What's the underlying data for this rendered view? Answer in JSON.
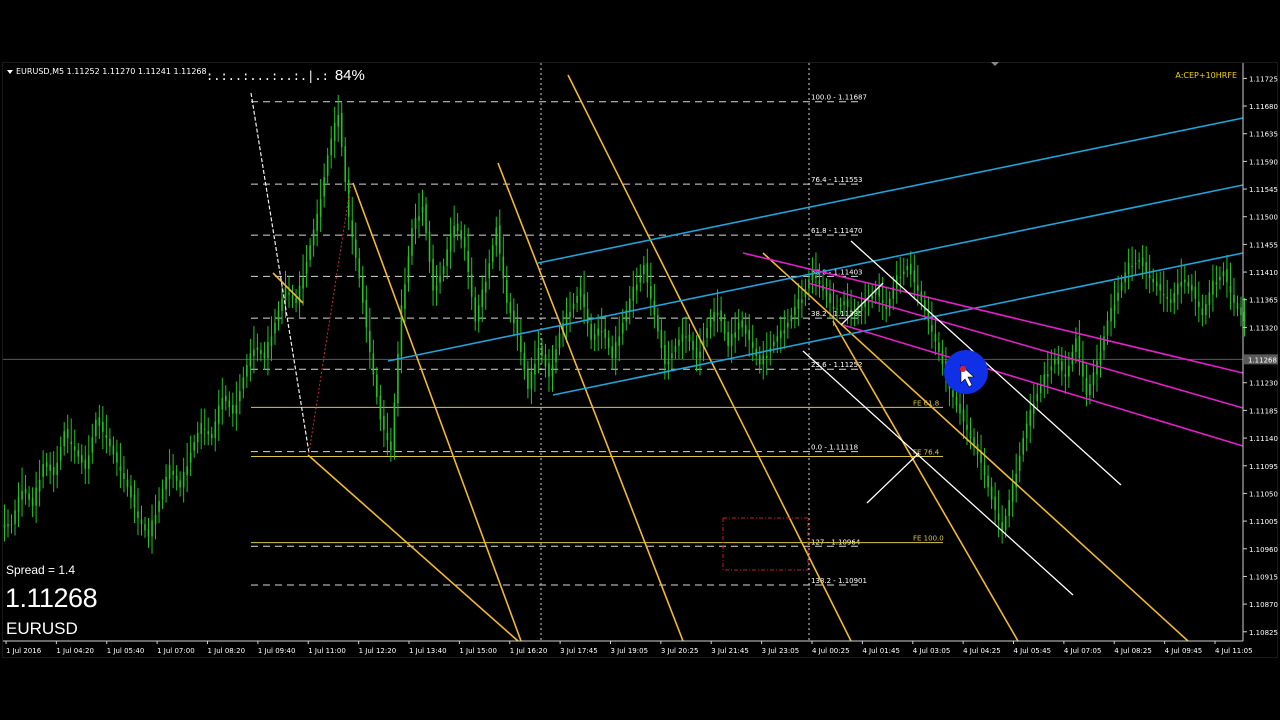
{
  "window": {
    "symbol_info": "EURUSD,M5  1.11252 1.11270 1.11241 1.11268",
    "timer_dots": ":.:..:...:..:.|.:",
    "timer_percent": "84%",
    "indicator_label": "A:CEP+10HRFE",
    "spread_text": "Spread = 1.4",
    "big_price": "1.11268",
    "big_symbol": "EURUSD"
  },
  "colors": {
    "background": "#000000",
    "candles": "#22c322",
    "yellow_channel": "#f2b830",
    "blue_channel": "#1fa3d8",
    "magenta_channel": "#e020c8",
    "white_lines": "#ffffff",
    "fib_dashed": "#d8d8d8",
    "fe_lines": "#d8c840",
    "current_price_line": "#5a5a5a",
    "price_tag_bg": "#5a5a5a",
    "cursor_circle": "#1030e8"
  },
  "chart_data": {
    "type": "line",
    "symbol": "EURUSD",
    "timeframe": "M5",
    "ohlc_current": {
      "open": 1.11252,
      "high": 1.1127,
      "low": 1.11241,
      "close": 1.11268
    },
    "current_price": 1.11268,
    "ylim": [
      1.1081,
      1.1175
    ],
    "y_ticks": [
      1.11725,
      1.1168,
      1.11635,
      1.1159,
      1.11545,
      1.115,
      1.11455,
      1.1141,
      1.11365,
      1.1132,
      1.1123,
      1.11185,
      1.1114,
      1.11095,
      1.1105,
      1.11005,
      1.1096,
      1.10915,
      1.1087,
      1.10825
    ],
    "y_tick_labels": [
      "1.11725",
      "1.11680",
      "1.11635",
      "1.11590",
      "1.11545",
      "1.11500",
      "1.11455",
      "1.11410",
      "1.11365",
      "1.11320",
      "1.11230",
      "1.11185",
      "1.11140",
      "1.11095",
      "1.11050",
      "1.11005",
      "1.10960",
      "1.10915",
      "1.10870",
      "1.10825"
    ],
    "x_labels": [
      "1 Jul 2016",
      "1 Jul 04:20",
      "1 Jul 05:40",
      "1 Jul 07:00",
      "1 Jul 08:20",
      "1 Jul 09:40",
      "1 Jul 11:00",
      "1 Jul 12:20",
      "1 Jul 13:40",
      "1 Jul 15:00",
      "1 Jul 16:20",
      "3 Jul 17:45",
      "3 Jul 19:05",
      "3 Jul 20:25",
      "3 Jul 21:45",
      "3 Jul 23:05",
      "4 Jul 00:25",
      "4 Jul 01:45",
      "4 Jul 03:05",
      "4 Jul 04:25",
      "4 Jul 05:45",
      "4 Jul 07:05",
      "4 Jul 08:25",
      "4 Jul 09:45",
      "4 Jul 11:05"
    ],
    "series": [
      {
        "values": [
          1.11,
          1.1106,
          1.1103,
          1.111,
          1.1108,
          1.1115,
          1.1112,
          1.1109,
          1.1117,
          1.1114,
          1.111,
          1.1106,
          1.1101,
          1.1098,
          1.1104,
          1.1109,
          1.1106,
          1.1112,
          1.1116,
          1.1114,
          1.1121,
          1.1118,
          1.1124,
          1.1129,
          1.1127,
          1.1133,
          1.1138,
          1.1136,
          1.1143,
          1.115,
          1.116,
          1.1167,
          1.115,
          1.114,
          1.1128,
          1.1117,
          1.1112,
          1.1135,
          1.1148,
          1.1152,
          1.1138,
          1.1142,
          1.1149,
          1.1145,
          1.1133,
          1.114,
          1.1148,
          1.1136,
          1.1131,
          1.1122,
          1.1129,
          1.1124,
          1.1131,
          1.1135,
          1.1138,
          1.113,
          1.1132,
          1.1127,
          1.1133,
          1.1138,
          1.1142,
          1.1134,
          1.1126,
          1.1129,
          1.1131,
          1.1127,
          1.1132,
          1.1135,
          1.1129,
          1.1133,
          1.113,
          1.1126,
          1.1129,
          1.1131,
          1.1134,
          1.1137,
          1.1141,
          1.1138,
          1.1135,
          1.1136,
          1.1134,
          1.1136,
          1.1138,
          1.1135,
          1.114,
          1.1142,
          1.1138,
          1.1133,
          1.1128,
          1.1122,
          1.1118,
          1.1114,
          1.111,
          1.1104,
          1.1099,
          1.1106,
          1.1114,
          1.112,
          1.1124,
          1.1127,
          1.1124,
          1.113,
          1.1121,
          1.1126,
          1.1133,
          1.1138,
          1.1142,
          1.1143,
          1.114,
          1.1138,
          1.1136,
          1.114,
          1.1138,
          1.1134,
          1.1139,
          1.1141,
          1.1136,
          1.1133
        ]
      }
    ],
    "fibonacci_retracement": [
      {
        "label": "100.0 - 1.11687",
        "value": 1.11687
      },
      {
        "label": "76.4 - 1.11553",
        "value": 1.11553
      },
      {
        "label": "61.8 - 1.11470",
        "value": 1.1147
      },
      {
        "label": "50.0 - 1.11403",
        "value": 1.11403
      },
      {
        "label": "38.2 - 1.11335",
        "value": 1.11335
      },
      {
        "label": "23.6 - 1.11252",
        "value": 1.11252
      },
      {
        "label": "0.0 - 1.11118",
        "value": 1.11118
      },
      {
        "label": "127 - 1.10964",
        "value": 1.10964
      },
      {
        "label": "138.2 - 1.10901",
        "value": 1.10901
      }
    ],
    "fibonacci_expansion": [
      {
        "label": "FE 61.8",
        "value": 1.1119
      },
      {
        "label": "FE 76.4",
        "value": 1.1111
      },
      {
        "label": "FE 100.0",
        "value": 1.1097
      }
    ],
    "grid": false,
    "legend": "none"
  }
}
